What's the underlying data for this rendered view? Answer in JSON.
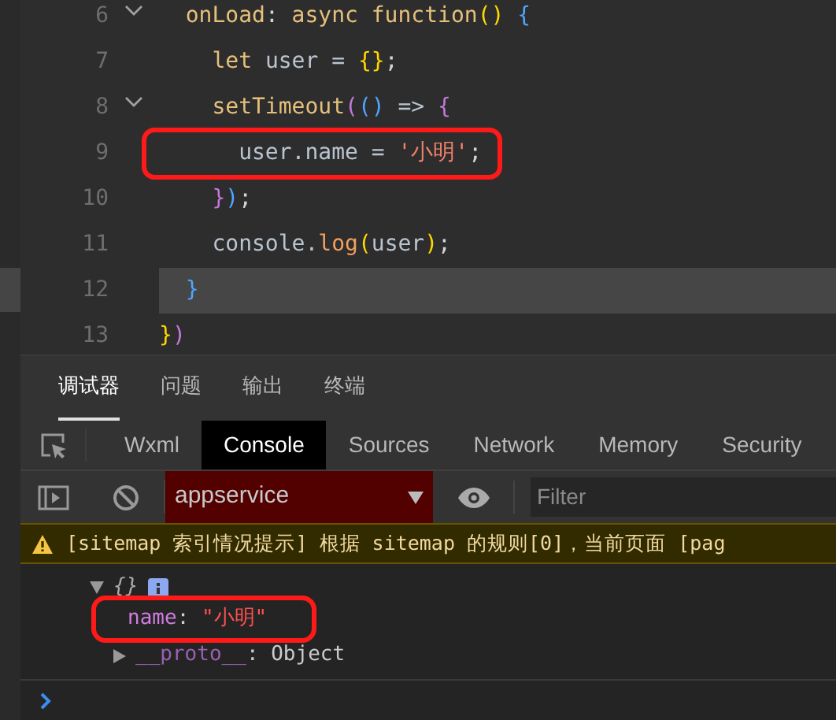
{
  "editor": {
    "lines": [
      {
        "number": "6",
        "fold": true,
        "current": false,
        "highlighted": false,
        "tokens": [
          {
            "kind": "keyword",
            "text": "  onLoad"
          },
          {
            "kind": "plain",
            "text": ": "
          },
          {
            "kind": "keyword",
            "text": "async function"
          },
          {
            "kind": "bracket",
            "text": "()"
          },
          {
            "kind": "brace",
            "text": " {"
          }
        ]
      },
      {
        "number": "7",
        "fold": false,
        "current": false,
        "highlighted": false,
        "tokens": [
          {
            "kind": "keyword",
            "text": "    let"
          },
          {
            "kind": "variable",
            "text": " user = "
          },
          {
            "kind": "bracket",
            "text": "{}"
          },
          {
            "kind": "plain",
            "text": ";"
          }
        ]
      },
      {
        "number": "8",
        "fold": true,
        "current": false,
        "highlighted": false,
        "tokens": [
          {
            "kind": "keyword",
            "text": "    setTimeout"
          },
          {
            "kind": "paren",
            "text": "("
          },
          {
            "kind": "brace",
            "text": "()"
          },
          {
            "kind": "variable",
            "text": " => "
          },
          {
            "kind": "paren",
            "text": "{"
          }
        ]
      },
      {
        "number": "9",
        "fold": false,
        "current": false,
        "highlighted": true,
        "tokens": [
          {
            "kind": "variable",
            "text": "      user.name = "
          },
          {
            "kind": "string",
            "text": "'小明'"
          },
          {
            "kind": "plain",
            "text": ";"
          }
        ]
      },
      {
        "number": "10",
        "fold": false,
        "current": false,
        "highlighted": false,
        "tokens": [
          {
            "kind": "paren",
            "text": "    }"
          },
          {
            "kind": "brace",
            "text": ")"
          },
          {
            "kind": "plain",
            "text": ";"
          }
        ]
      },
      {
        "number": "11",
        "fold": false,
        "current": false,
        "highlighted": false,
        "tokens": [
          {
            "kind": "variable",
            "text": "    console."
          },
          {
            "kind": "function",
            "text": "log"
          },
          {
            "kind": "bracket",
            "text": "("
          },
          {
            "kind": "variable",
            "text": "user"
          },
          {
            "kind": "bracket",
            "text": ")"
          },
          {
            "kind": "plain",
            "text": ";"
          }
        ]
      },
      {
        "number": "12",
        "fold": false,
        "current": true,
        "highlighted": false,
        "tokens": [
          {
            "kind": "brace",
            "text": "  }"
          }
        ]
      },
      {
        "number": "13",
        "fold": false,
        "current": false,
        "highlighted": false,
        "tokens": [
          {
            "kind": "bracket",
            "text": "}"
          },
          {
            "kind": "paren",
            "text": ")"
          }
        ]
      }
    ]
  },
  "panel_tabs": [
    {
      "label": "调试器",
      "selected": true
    },
    {
      "label": "问题",
      "selected": false
    },
    {
      "label": "输出",
      "selected": false
    },
    {
      "label": "终端",
      "selected": false
    }
  ],
  "devtools_tabs": [
    {
      "label": "Wxml",
      "selected": false
    },
    {
      "label": "Console",
      "selected": true
    },
    {
      "label": "Sources",
      "selected": false
    },
    {
      "label": "Network",
      "selected": false
    },
    {
      "label": "Memory",
      "selected": false
    },
    {
      "label": "Security",
      "selected": false
    }
  ],
  "console_toolbar": {
    "context": "appservice",
    "filter_placeholder": "Filter"
  },
  "console": {
    "messages": [
      {
        "kind": "warning",
        "text": "[sitemap 索引情况提示] 根据 sitemap 的规则[0]，当前页面 [pag"
      }
    ],
    "object": {
      "preview": "{}",
      "expanded": true,
      "properties": [
        {
          "key": "name",
          "separator": ":",
          "value": "\"小明\"",
          "highlighted": true
        }
      ],
      "proto": {
        "key": "__proto__",
        "separator": ":",
        "value": "Object",
        "expanded": false
      }
    }
  }
}
